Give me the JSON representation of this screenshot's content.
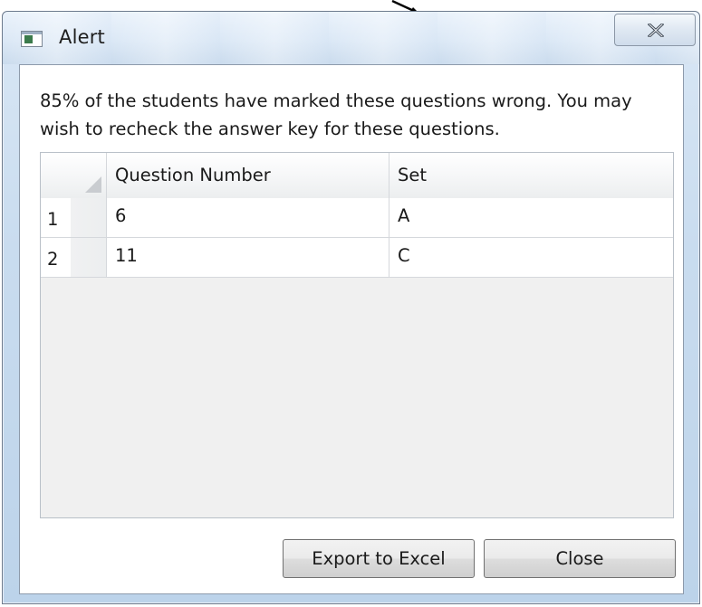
{
  "window": {
    "title": "Alert",
    "close_glyph": "✕"
  },
  "message": "85% of the students have marked these questions wrong. You may wish to recheck the answer key for these questions.",
  "grid": {
    "columns": [
      "Question Number",
      "Set"
    ],
    "rows": [
      {
        "index": "1",
        "question": "6",
        "set": "A"
      },
      {
        "index": "2",
        "question": "11",
        "set": "C"
      }
    ]
  },
  "buttons": {
    "export_label": "Export to Excel",
    "close_label": "Close"
  },
  "icons": {
    "title_icon": "window-app-icon",
    "close_icon": "close-icon",
    "corner_icon": "select-all-corner-icon",
    "pointer_arrow": "pointer-arrow-icon"
  },
  "colors": {
    "window_frame": "#c9dcef",
    "client_bg": "#ffffff",
    "grid_empty_bg": "#f0f0f0"
  }
}
